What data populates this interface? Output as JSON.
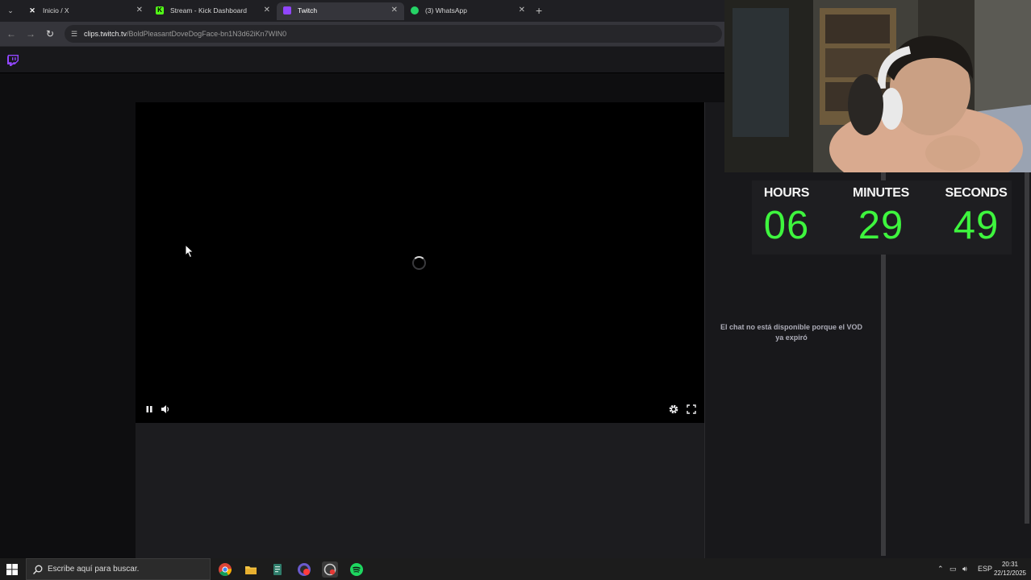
{
  "browser": {
    "tabs": [
      {
        "title": "Inicio / X",
        "icon": "x-logo-icon"
      },
      {
        "title": "Stream - Kick Dashboard",
        "icon": "kick-logo-icon"
      },
      {
        "title": "Twitch",
        "icon": "twitch-logo-icon",
        "active": true
      },
      {
        "title": "(3) WhatsApp",
        "icon": "whatsapp-logo-icon"
      }
    ],
    "url_host": "clips.twitch.tv",
    "url_path": "/BoldPleasantDoveDogFace-bn1N3d62iKn7WIN0"
  },
  "chat": {
    "unavailable_message": "El chat no está disponible porque el VOD ya expiró"
  },
  "timer": {
    "hours_label": "HOURS",
    "minutes_label": "MINUTES",
    "seconds_label": "SECONDS",
    "hours": "06",
    "minutes": "29",
    "seconds": "49",
    "digit_color": "#3ef53e"
  },
  "taskbar": {
    "search_placeholder": "Escribe aquí para buscar.",
    "language": "ESP",
    "time": "20:31",
    "date": "22/12/2025"
  },
  "colors": {
    "twitch_purple": "#9146ff",
    "page_bg": "#0e0e10"
  }
}
